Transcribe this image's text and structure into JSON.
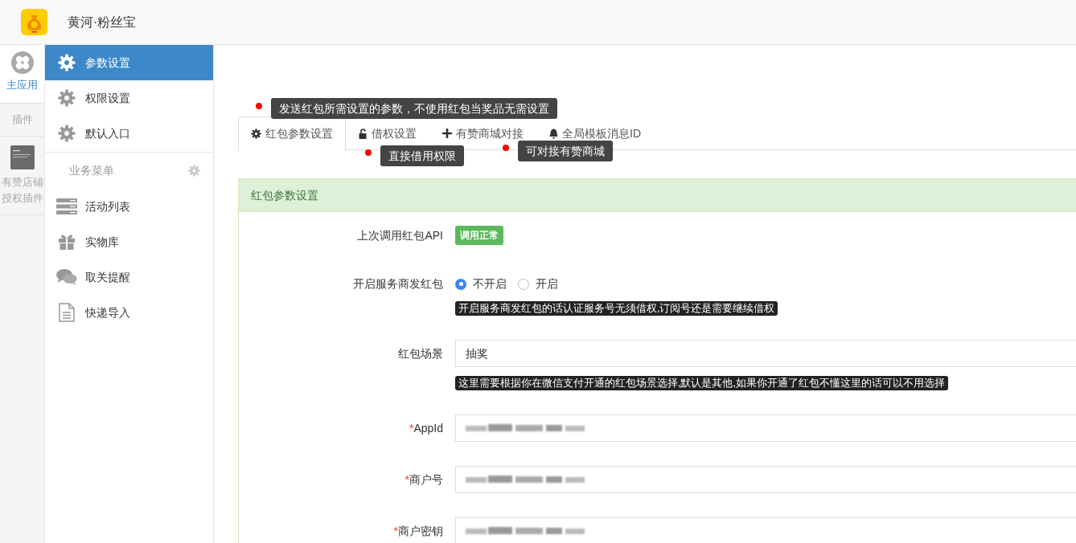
{
  "header": {
    "title": "黄河·粉丝宝"
  },
  "app_rail": [
    {
      "kind": "apps",
      "label": "主应用",
      "selected": true
    },
    {
      "kind": "section",
      "label": "插件",
      "selected": false
    },
    {
      "kind": "plugin",
      "label": "有赞店铺授权插件",
      "selected": false
    }
  ],
  "menu": {
    "items": [
      {
        "kind": "settings",
        "label": "参数设置",
        "selected": true
      },
      {
        "kind": "settings",
        "label": "权限设置",
        "selected": false
      },
      {
        "kind": "settings",
        "label": "默认入口",
        "selected": false
      }
    ],
    "section_title": "业务菜单",
    "business_items": [
      {
        "kind": "list",
        "label": "活动列表",
        "selected": false
      },
      {
        "kind": "gift",
        "label": "实物库",
        "selected": false
      },
      {
        "kind": "chat",
        "label": "取关提醒",
        "selected": false
      },
      {
        "kind": "document",
        "label": "快递导入",
        "selected": false
      }
    ]
  },
  "tabs": [
    {
      "kind": "settings",
      "label": "红包参数设置",
      "selected": true,
      "tip": "发送红包所需设置的参数，不使用红包当奖品无需设置"
    },
    {
      "kind": "unlock",
      "label": "借权设置",
      "selected": false,
      "tip": "直接借用权限"
    },
    {
      "kind": "plus",
      "label": "有赞商城对接",
      "selected": false,
      "tip": "可对接有赞商城"
    },
    {
      "kind": "bell",
      "label": "全局模板消息ID",
      "selected": false
    }
  ],
  "panel": {
    "title": "红包参数设置",
    "fields": [
      {
        "kind": "status",
        "label": "上次调用红包API",
        "value": "调用正常"
      },
      {
        "kind": "radio",
        "label": "开启服务商发红包",
        "options": [
          {
            "label": "不开启",
            "selected": true
          },
          {
            "label": "开启",
            "selected": false
          }
        ],
        "hint": "开启服务商发红包的话认证服务号无须借权,订阅号还是需要继续借权"
      },
      {
        "kind": "input",
        "label": "红包场景",
        "value": "抽奖",
        "hint": "这里需要根据你在微信支付开通的红包场景选择,默认是其他,如果你开通了红包不懂这里的话可以不用选择"
      },
      {
        "kind": "input",
        "required_mark": "*",
        "label": "AppId",
        "value_redacted": true
      },
      {
        "kind": "input",
        "required_mark": "*",
        "label": "商户号",
        "value_redacted": true
      },
      {
        "kind": "input",
        "required_mark": "*",
        "label": "商户密钥",
        "value_redacted": true
      }
    ]
  }
}
